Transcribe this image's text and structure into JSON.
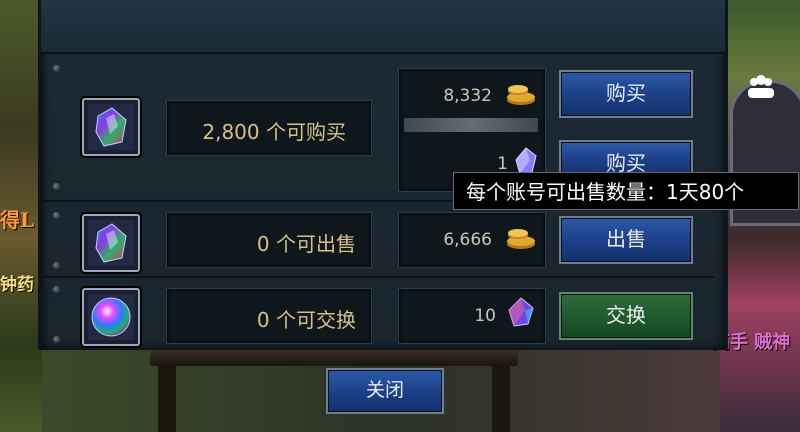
{
  "rows": [
    {
      "count_text": "2,800 个可购买",
      "price": "8,332",
      "secondary_price": "1",
      "button": "购买",
      "secondary_button": "购买"
    },
    {
      "count_text": "0 个可出售",
      "price": "6,666",
      "button": "出售"
    },
    {
      "count_text": "0 个可交换",
      "price": "10",
      "button": "交换"
    }
  ],
  "close_button": "关闭",
  "tooltip": "每个账号可出售数量：1天80个",
  "side_texts": {
    "left_1": "得L",
    "left_2": "钟药",
    "right_1": "高手 贼神"
  },
  "icons": {
    "row1": "rainbow-crystal-icon",
    "row2": "rainbow-crystal-icon",
    "row3": "rainbow-orb-icon",
    "coin": "gold-coin-icon",
    "secondary_currency": "crystal-shard-icon",
    "row3_currency": "gem-icon",
    "group": "guild-icon"
  }
}
